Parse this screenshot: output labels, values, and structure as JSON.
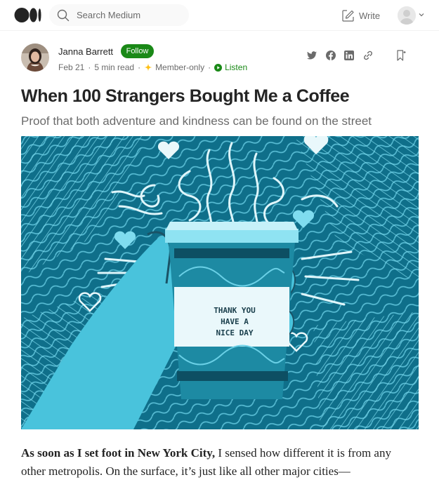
{
  "header": {
    "logo_icon": "medium-logo-icon",
    "search_placeholder": "Search Medium",
    "write_label": "Write"
  },
  "author": {
    "name": "Janna Barrett",
    "follow_label": "Follow",
    "date": "Feb 21",
    "read_time": "5 min read",
    "membership": "Member-only",
    "listen_label": "Listen"
  },
  "share_icons": [
    "twitter-icon",
    "facebook-icon",
    "linkedin-icon",
    "link-icon",
    "bookmark-icon"
  ],
  "article": {
    "title": "When 100 Strangers Bought Me a Coffee",
    "subtitle": "Proof that both adventure and kindness can be found on the street",
    "image": {
      "cup_text_line1": "THANK YOU",
      "cup_text_line2": "HAVE A",
      "cup_text_line3": "NICE DAY"
    },
    "body_bold": "As soon as I set foot in New York City,",
    "body_rest": " I sensed how different it is from any other metropolis. On the surface, it’s just like all other major cities—"
  },
  "colors": {
    "accent_green": "#1a8917",
    "member_star": "#ffc017",
    "illustration_blue": "#0f6f8a"
  }
}
